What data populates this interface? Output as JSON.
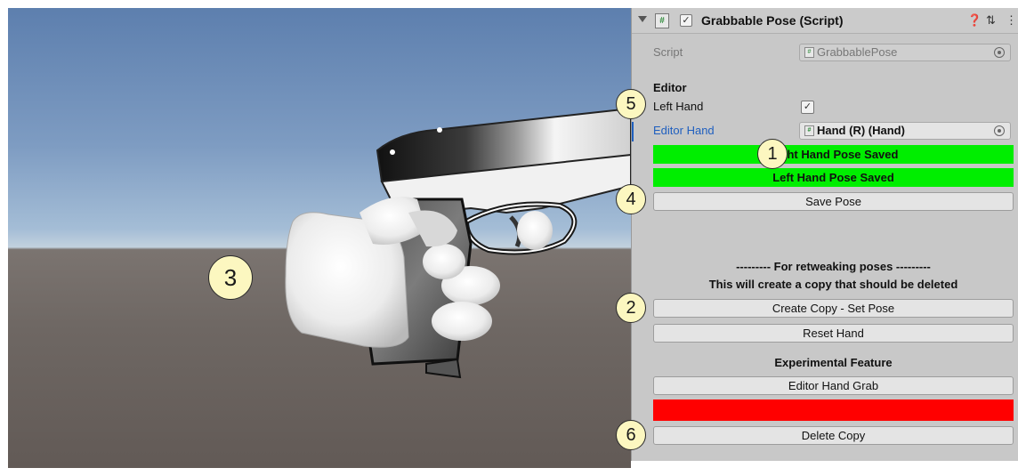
{
  "scene": {
    "callouts": {
      "c3": "3"
    }
  },
  "inspector": {
    "component_title": "Grabbable Pose (Script)",
    "script_label": "Script",
    "script_value": "GrabbablePose",
    "section_editor": "Editor",
    "left_hand_label": "Left Hand",
    "left_hand_checked": true,
    "editor_hand_label": "Editor Hand",
    "editor_hand_value": "Hand (R) (Hand)",
    "right_pose_status": "Right Hand Pose Saved",
    "left_pose_status": "Left Hand Pose Saved",
    "save_pose_button": "Save Pose",
    "retweak_heading": "--------- For retweaking poses ---------",
    "retweak_note": "This will create a copy that should be deleted",
    "create_copy_button": "Create Copy - Set Pose",
    "reset_hand_button": "Reset Hand",
    "experimental_heading": "Experimental Feature",
    "editor_hand_grab_button": "Editor Hand Grab",
    "delete_copy_button": "Delete Copy",
    "colors": {
      "status_green": "#00ee00",
      "status_red": "#ff0000",
      "label_blue": "#1f5fbf"
    },
    "callouts": {
      "c1": "1",
      "c2": "2",
      "c4": "4",
      "c5": "5",
      "c6": "6"
    }
  }
}
